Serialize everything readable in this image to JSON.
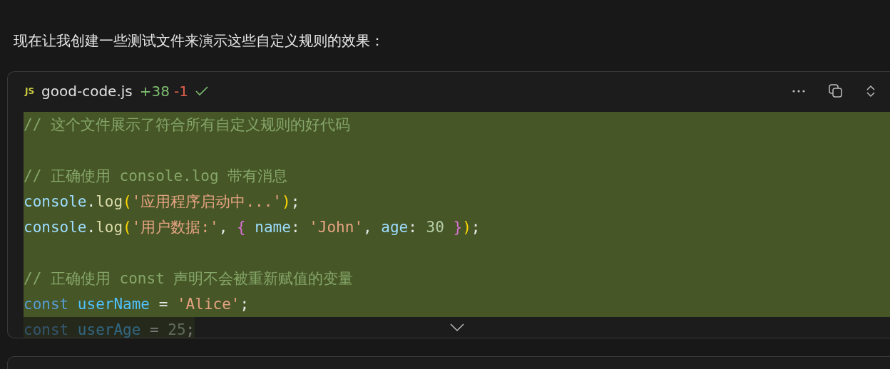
{
  "intro": "现在让我创建一些测试文件来演示这些自定义规则的效果：",
  "file_card": {
    "badge": "JS",
    "filename": "good-code.js",
    "added": "+38",
    "removed": "-1",
    "applied": true,
    "lines": [
      {
        "added": true,
        "faded": false,
        "tokens": [
          {
            "kind": "comment",
            "text": "// 这个文件展示了符合所有自定义规则的好代码"
          }
        ]
      },
      {
        "added": true,
        "faded": false
      },
      {
        "added": true,
        "faded": false,
        "tokens": [
          {
            "kind": "comment",
            "text": "// 正确使用 console.log 带有消息"
          }
        ]
      },
      {
        "added": true,
        "faded": false,
        "tokens": [
          {
            "kind": "var",
            "text": "console"
          },
          {
            "kind": "plain",
            "text": "."
          },
          {
            "kind": "fn",
            "text": "log"
          },
          {
            "kind": "paren",
            "text": "("
          },
          {
            "kind": "string",
            "text": "'应用程序启动中...'"
          },
          {
            "kind": "paren",
            "text": ")"
          },
          {
            "kind": "plain",
            "text": ";"
          }
        ]
      },
      {
        "added": true,
        "faded": false,
        "tokens": [
          {
            "kind": "var",
            "text": "console"
          },
          {
            "kind": "plain",
            "text": "."
          },
          {
            "kind": "fn",
            "text": "log"
          },
          {
            "kind": "paren",
            "text": "("
          },
          {
            "kind": "string",
            "text": "'用户数据:'"
          },
          {
            "kind": "plain",
            "text": ", "
          },
          {
            "kind": "brace",
            "text": "{ "
          },
          {
            "kind": "var",
            "text": "name"
          },
          {
            "kind": "plain",
            "text": ": "
          },
          {
            "kind": "string",
            "text": "'John'"
          },
          {
            "kind": "plain",
            "text": ", "
          },
          {
            "kind": "var",
            "text": "age"
          },
          {
            "kind": "plain",
            "text": ": "
          },
          {
            "kind": "number",
            "text": "30 "
          },
          {
            "kind": "brace",
            "text": "}"
          },
          {
            "kind": "paren",
            "text": ")"
          },
          {
            "kind": "plain",
            "text": ";"
          }
        ]
      },
      {
        "added": true,
        "faded": false
      },
      {
        "added": true,
        "faded": false,
        "tokens": [
          {
            "kind": "comment",
            "text": "// 正确使用 const 声明不会被重新赋值的变量"
          }
        ]
      },
      {
        "added": true,
        "faded": false,
        "tokens": [
          {
            "kind": "keyword",
            "text": "const "
          },
          {
            "kind": "const",
            "text": "userName"
          },
          {
            "kind": "plain",
            "text": " = "
          },
          {
            "kind": "string",
            "text": "'Alice'"
          },
          {
            "kind": "plain",
            "text": ";"
          }
        ]
      },
      {
        "added": true,
        "faded": true,
        "tokens": [
          {
            "kind": "keyword",
            "text": "const "
          },
          {
            "kind": "const",
            "text": "userAge"
          },
          {
            "kind": "plain",
            "text": " = "
          },
          {
            "kind": "number",
            "text": "25"
          },
          {
            "kind": "plain",
            "text": ";"
          }
        ]
      }
    ]
  }
}
